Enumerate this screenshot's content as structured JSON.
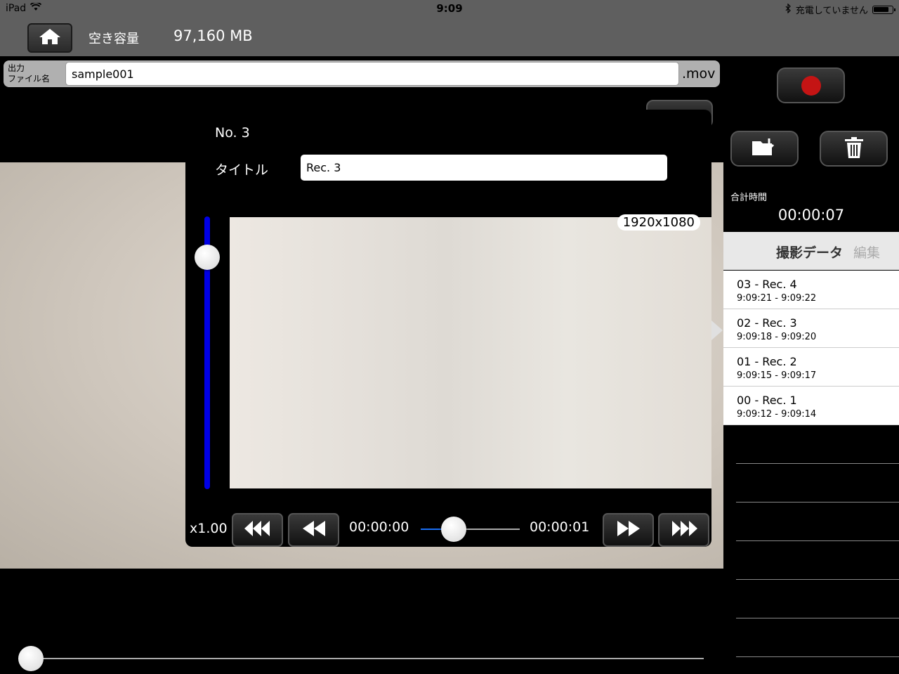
{
  "status_bar": {
    "device": "iPad",
    "time": "9:09",
    "charge_status": "充電していません",
    "battery_level": 0.85
  },
  "header": {
    "free_space_label": "空き容量",
    "free_space_value": "97,160 MB"
  },
  "filename": {
    "label_line1": "出力",
    "label_line2": "ファイル名",
    "value": "sample001",
    "extension": ".mov"
  },
  "totals": {
    "label": "合計時間",
    "value": "00:00:07"
  },
  "recordings": {
    "title": "撮影データ",
    "edit_label": "編集",
    "items": [
      {
        "name": "03 - Rec. 4",
        "time": "9:09:21 - 9:09:22"
      },
      {
        "name": "02 - Rec. 3",
        "time": "9:09:18 - 9:09:20"
      },
      {
        "name": "01 - Rec. 2",
        "time": "9:09:15 - 9:09:17"
      },
      {
        "name": "00 - Rec. 1",
        "time": "9:09:12 - 9:09:14"
      }
    ]
  },
  "popover": {
    "number": "No. 3",
    "title_label": "タイトル",
    "title_value": "Rec. 3",
    "resolution": "1920x1080",
    "speed": "x1.00",
    "current_time": "00:00:00",
    "end_time": "00:00:01",
    "playback_position": 0.33,
    "volume_level": 0.85
  },
  "colors": {
    "record": "#c41414",
    "volume_track": "#0000e6",
    "progress_fill": "#1a6ef5"
  },
  "icons": {
    "home": "house-icon",
    "record": "record-icon",
    "import": "folder-import-icon",
    "trash": "trash-icon",
    "skip_back": "triple-rewind-icon",
    "rewind": "rewind-icon",
    "forward": "fast-forward-icon",
    "skip_forward": "triple-forward-icon"
  }
}
